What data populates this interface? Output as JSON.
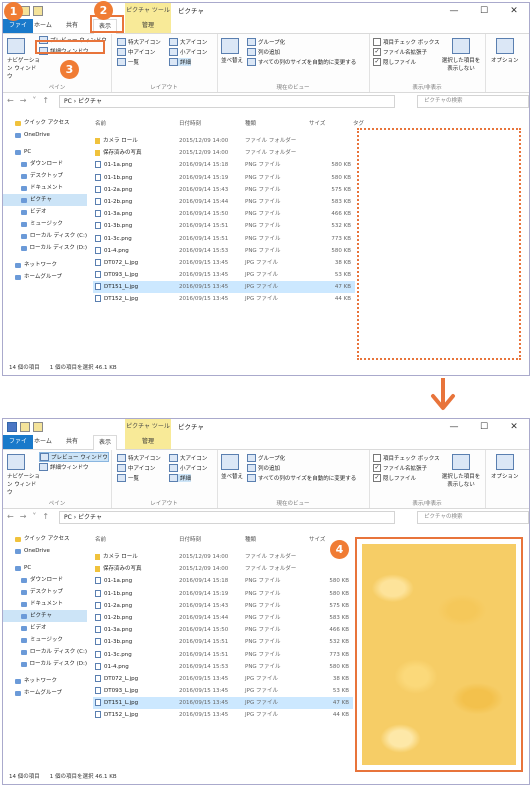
{
  "window": {
    "context_tab": "ピクチャ ツール",
    "title": "ピクチャ",
    "tabs": [
      "ファイル",
      "ホーム",
      "共有",
      "表示",
      "管理"
    ]
  },
  "ribbon": {
    "panes": {
      "nav_pane": "ナビゲーション ウィンドウ",
      "preview_pane": "プレビュー ウィンドウ",
      "details_pane": "詳細ウィンドウ",
      "label": "ペイン"
    },
    "layout": {
      "extra_large": "特大アイコン",
      "large": "大アイコン",
      "medium": "中アイコン",
      "small": "小アイコン",
      "list": "一覧",
      "details": "詳細",
      "label": "レイアウト"
    },
    "current_view": {
      "sort": "並べ替え",
      "group": "グループ化",
      "add_col": "列の追加",
      "fit_cols": "すべての列のサイズを自動的に変更する",
      "label": "現在のビュー"
    },
    "show_hide": {
      "item_check": "項目チェック ボックス",
      "file_ext": "ファイル名拡張子",
      "hidden": "隠しファイル",
      "hide_selected": "選択した項目を 表示しない",
      "label": "表示/非表示"
    },
    "options": "オプション"
  },
  "address": {
    "path": "PC › ピクチャ",
    "search_placeholder": "ピクチャの検索"
  },
  "sidebar": [
    {
      "label": "クイック アクセス",
      "lvl": 1,
      "icon": "star-icon"
    },
    {
      "label": "OneDrive",
      "lvl": 1,
      "icon": "cloud-icon"
    },
    {
      "label": "PC",
      "lvl": 1,
      "icon": "pc-icon"
    },
    {
      "label": "ダウンロード",
      "lvl": 2,
      "icon": "download-icon"
    },
    {
      "label": "デスクトップ",
      "lvl": 2,
      "icon": "desktop-icon"
    },
    {
      "label": "ドキュメント",
      "lvl": 2,
      "icon": "document-icon"
    },
    {
      "label": "ピクチャ",
      "lvl": 2,
      "icon": "pictures-icon"
    },
    {
      "label": "ビデオ",
      "lvl": 2,
      "icon": "video-icon"
    },
    {
      "label": "ミュージック",
      "lvl": 2,
      "icon": "music-icon"
    },
    {
      "label": "ローカル ディスク (C:)",
      "lvl": 2,
      "icon": "disk-icon"
    },
    {
      "label": "ローカル ディスク (D:)",
      "lvl": 2,
      "icon": "disk-icon"
    },
    {
      "label": "ネットワーク",
      "lvl": 1,
      "icon": "network-icon"
    },
    {
      "label": "ホームグループ",
      "lvl": 1,
      "icon": "homegroup-icon"
    }
  ],
  "columns": {
    "name": "名前",
    "date": "日付時刻",
    "type": "種類",
    "size": "サイズ",
    "tag": "タグ"
  },
  "files": [
    {
      "name": "カメラ ロール",
      "date": "2015/12/09 14:00",
      "type": "ファイル フォルダー",
      "size": "",
      "folder": true
    },
    {
      "name": "保存済みの写真",
      "date": "2015/12/09 14:00",
      "type": "ファイル フォルダー",
      "size": "",
      "folder": true
    },
    {
      "name": "01-1a.png",
      "date": "2016/09/14 15:18",
      "type": "PNG ファイル",
      "size": "580 KB"
    },
    {
      "name": "01-1b.png",
      "date": "2016/09/14 15:19",
      "type": "PNG ファイル",
      "size": "580 KB"
    },
    {
      "name": "01-2a.png",
      "date": "2016/09/14 15:43",
      "type": "PNG ファイル",
      "size": "575 KB"
    },
    {
      "name": "01-2b.png",
      "date": "2016/09/14 15:44",
      "type": "PNG ファイル",
      "size": "583 KB"
    },
    {
      "name": "01-3a.png",
      "date": "2016/09/14 15:50",
      "type": "PNG ファイル",
      "size": "466 KB"
    },
    {
      "name": "01-3b.png",
      "date": "2016/09/14 15:51",
      "type": "PNG ファイル",
      "size": "532 KB"
    },
    {
      "name": "01-3c.png",
      "date": "2016/09/14 15:51",
      "type": "PNG ファイル",
      "size": "773 KB"
    },
    {
      "name": "01-4.png",
      "date": "2016/09/14 15:53",
      "type": "PNG ファイル",
      "size": "580 KB"
    },
    {
      "name": "DT072_L.jpg",
      "date": "2016/09/15 13:45",
      "type": "JPG ファイル",
      "size": "38 KB"
    },
    {
      "name": "DT093_L.jpg",
      "date": "2016/09/15 13:45",
      "type": "JPG ファイル",
      "size": "53 KB"
    },
    {
      "name": "DT151_L.jpg",
      "date": "2016/09/15 13:45",
      "type": "JPG ファイル",
      "size": "47 KB",
      "selected": true
    },
    {
      "name": "DT152_L.jpg",
      "date": "2016/09/15 13:45",
      "type": "JPG ファイル",
      "size": "44 KB"
    }
  ],
  "status": {
    "count": "14 個の項目",
    "selection": "1 個の項目を選択  46.1 KB"
  },
  "badges": [
    "1",
    "2",
    "3",
    "4"
  ],
  "colors": {
    "accent": "#e8743b",
    "file_tab": "#1979ca",
    "context_tab": "#f8ea98"
  }
}
